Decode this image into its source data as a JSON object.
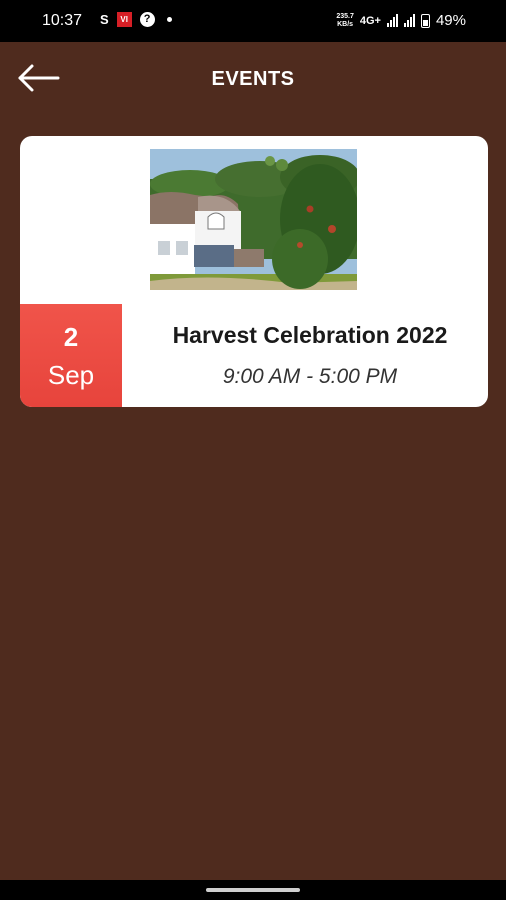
{
  "status_bar": {
    "time": "10:37",
    "left_icons": [
      "s-icon",
      "vi-icon",
      "help-icon",
      "dot-icon"
    ],
    "s_glyph": "S",
    "vi_glyph": "VI",
    "speed_value": "235.7",
    "speed_unit": "KB/s",
    "network": "4G+",
    "battery": "49%"
  },
  "header": {
    "title": "EVENTS",
    "back_icon": "arrow-left-icon"
  },
  "events": [
    {
      "day": "2",
      "month": "Sep",
      "title": "Harvest Celebration 2022",
      "time": "9:00 AM - 5:00 PM"
    }
  ],
  "colors": {
    "background": "#4f2b1e",
    "card": "#ffffff",
    "date_badge": "#ec4c43",
    "status_bar": "#000000"
  }
}
